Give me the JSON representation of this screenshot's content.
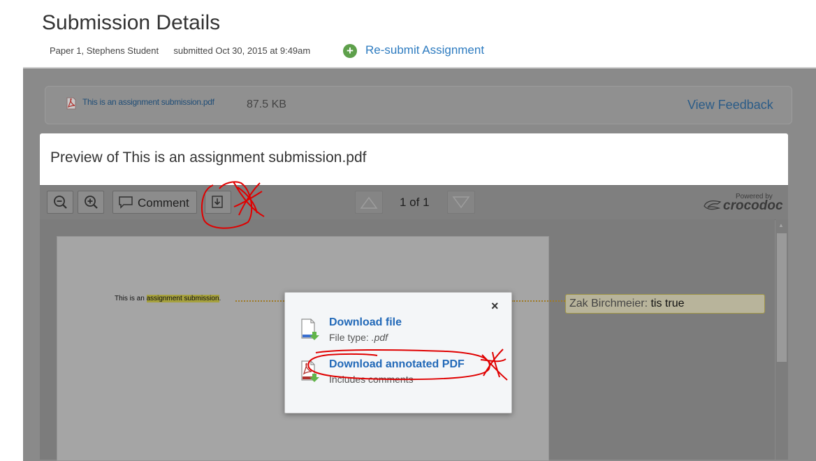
{
  "header": {
    "title": "Submission Details",
    "assignment_name": "Paper 1, Stephens Student",
    "submitted_text": "submitted Oct 30, 2015 at 9:49am",
    "resubmit_label": "Re-submit Assignment"
  },
  "file_bar": {
    "file_name": "This is an assignment submission.pdf",
    "file_size": "87.5 KB",
    "view_feedback_label": "View Feedback"
  },
  "preview": {
    "title": "Preview of This is an assignment submission.pdf"
  },
  "toolbar": {
    "comment_label": "Comment",
    "page_indicator": "1 of 1",
    "powered_by": "Powered by",
    "brand": "crocodoc"
  },
  "document": {
    "text_before": "This is an ",
    "highlighted_text": "assignment submission",
    "text_after": "."
  },
  "annotation": {
    "author": "Zak Birchmeier",
    "separator": ": ",
    "text": "tis true"
  },
  "download_popup": {
    "close_symbol": "×",
    "file_link_label": "Download file",
    "file_type_prefix": "File type: ",
    "file_type_value": ".pdf",
    "annotated_link_label": "Download annotated PDF",
    "annotated_sub": "Includes comments"
  },
  "colors": {
    "link": "#2d7bc0",
    "popup_link": "#2269b8",
    "annotation_mark": "#e00000",
    "resubmit_icon": "#5ea04b"
  }
}
